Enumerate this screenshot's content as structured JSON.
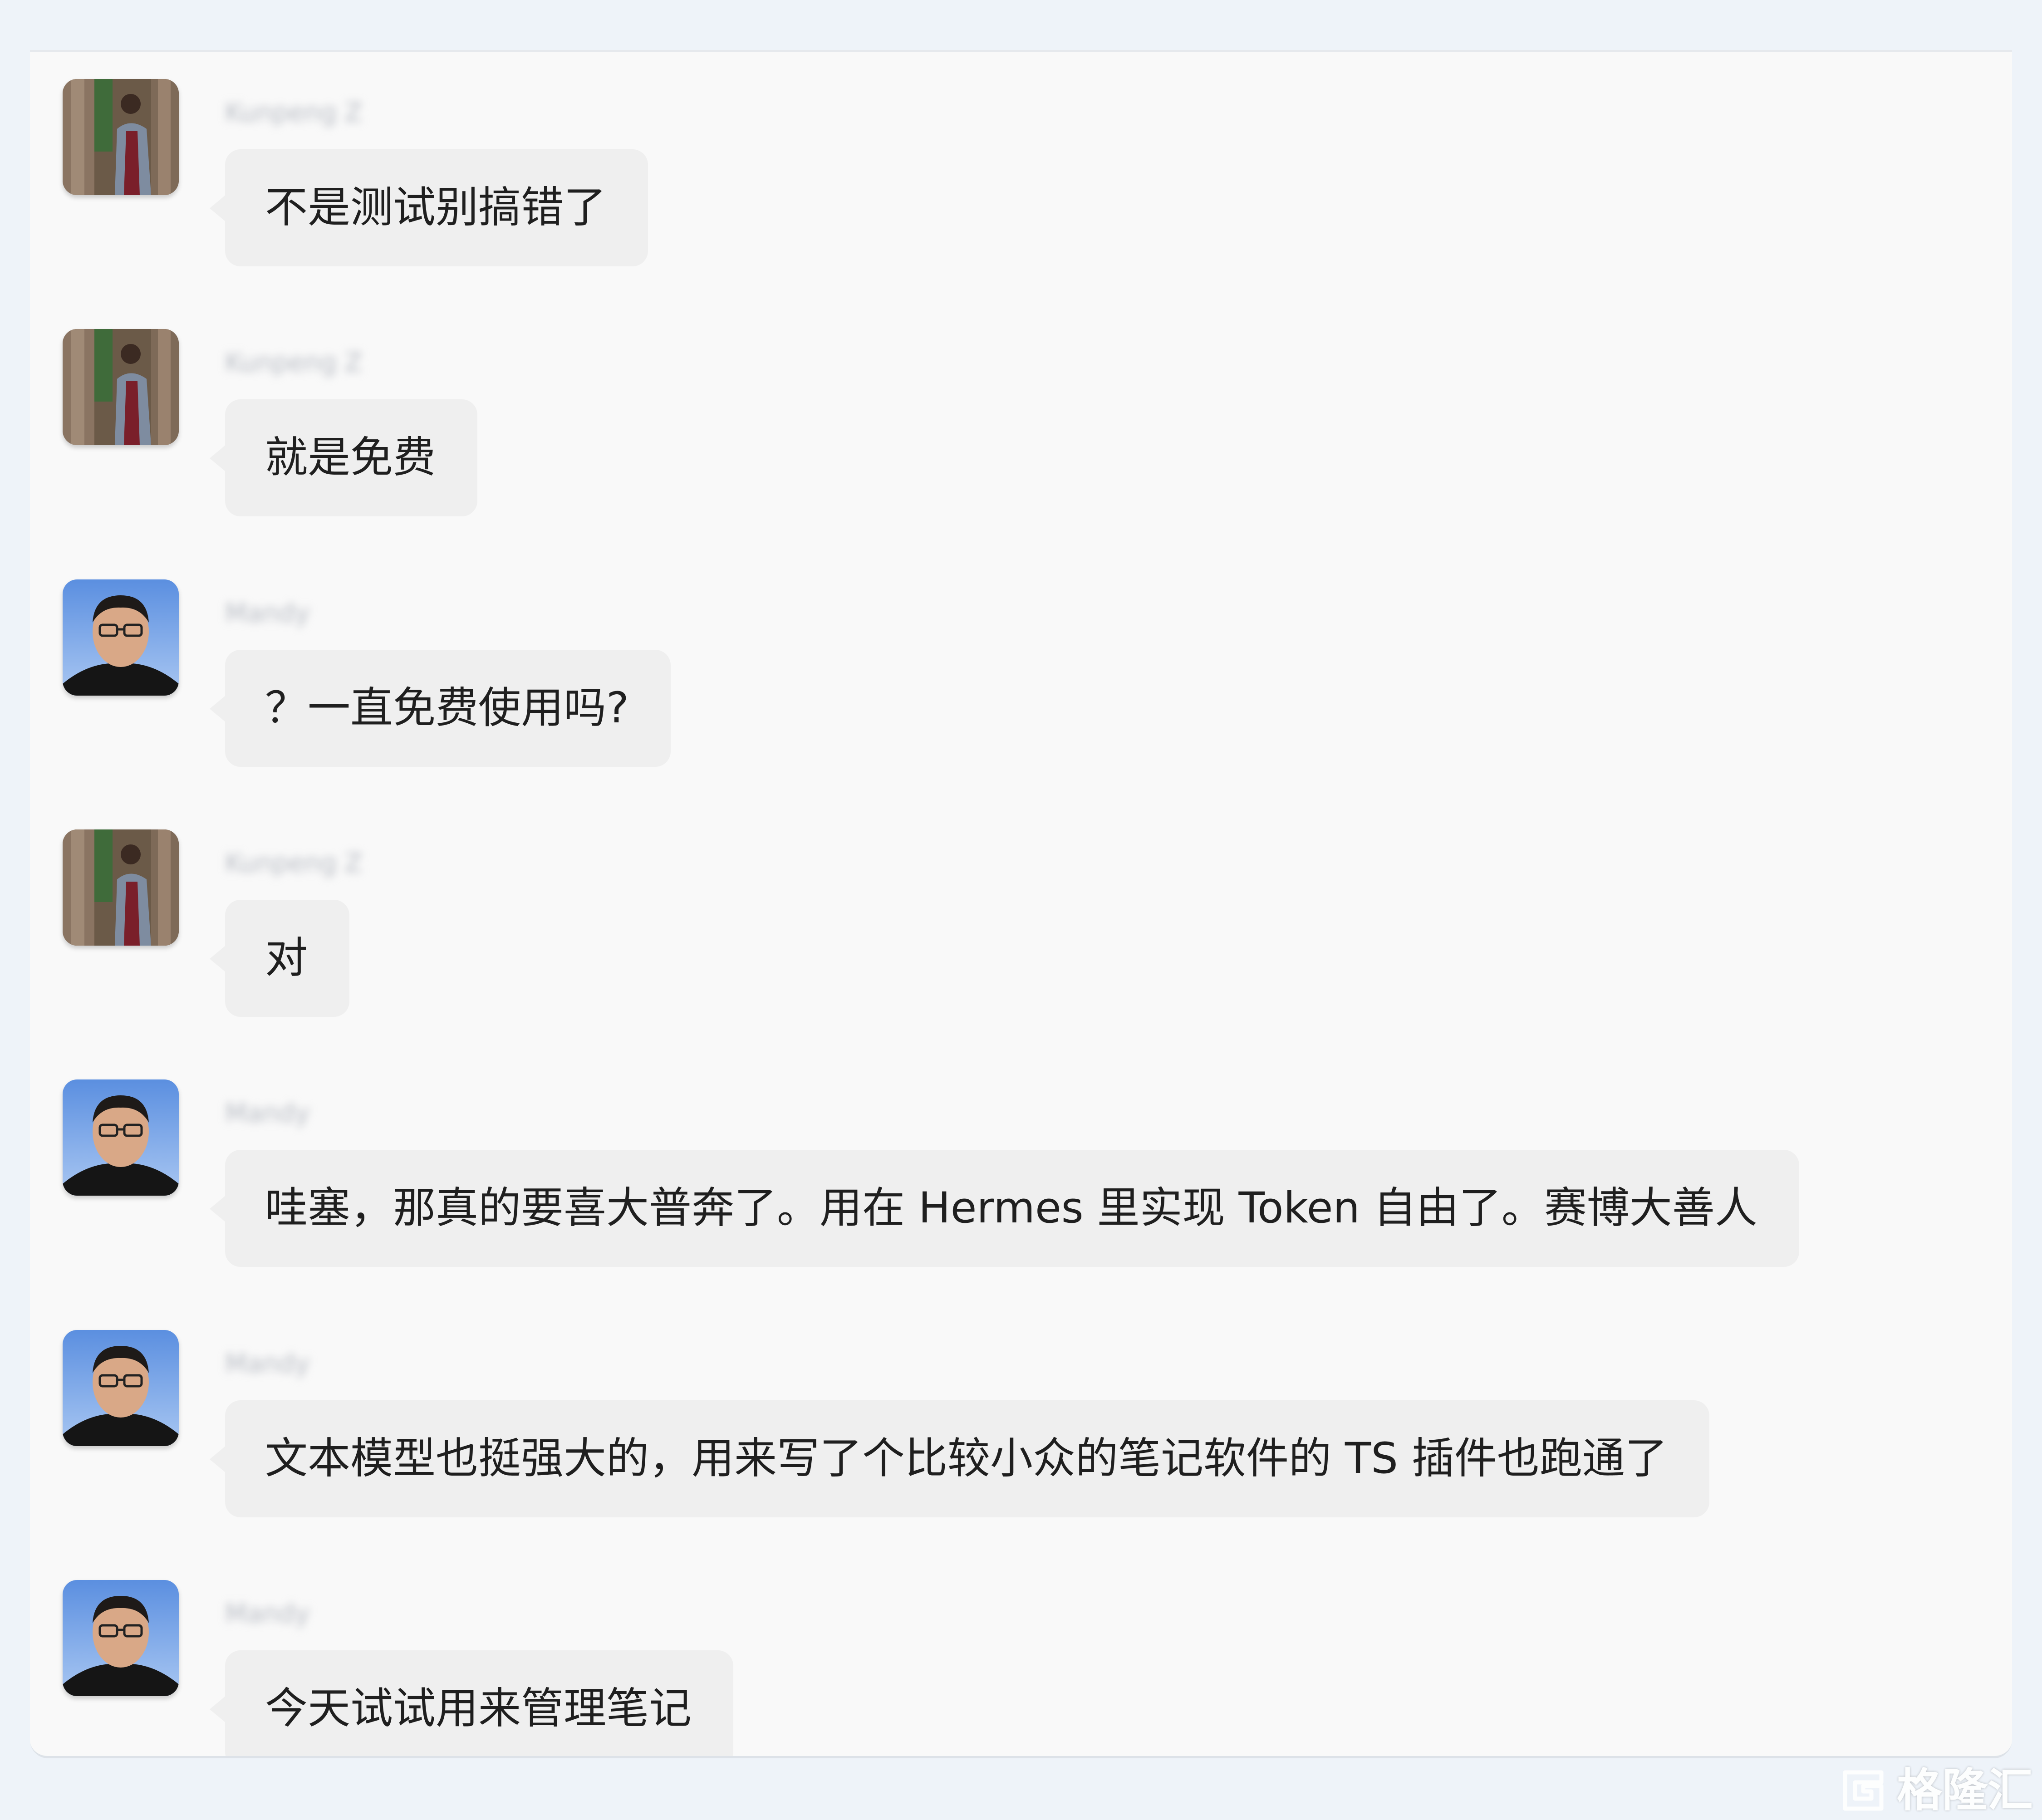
{
  "chat": {
    "messages": [
      {
        "sender": "Kunpeng Z",
        "avatar": "man-with-glasses-portrait-icon",
        "text": "不是测试别搞错了"
      },
      {
        "sender": "Kunpeng Z",
        "avatar": "man-with-glasses-portrait-icon",
        "text": "就是免费"
      },
      {
        "sender": "Mandy",
        "avatar": "man-portrait-icon",
        "text": "？一直免费使用吗?"
      },
      {
        "sender": "Kunpeng Z",
        "avatar": "man-with-glasses-portrait-icon",
        "text": "对"
      },
      {
        "sender": "Mandy",
        "avatar": "man-portrait-icon",
        "text": "哇塞，那真的要喜大普奔了。用在 Hermes 里实现 Token 自由了。赛博大善人"
      },
      {
        "sender": "Mandy",
        "avatar": "man-portrait-icon",
        "text": "文本模型也挺强大的，用来写了个比较小众的笔记软件的 TS 插件也跑通了"
      },
      {
        "sender": "Mandy",
        "avatar": "man-portrait-icon",
        "text": "今天试试用来管理笔记"
      }
    ]
  },
  "watermark": {
    "text": "格隆汇",
    "icon": "gelonghui-logo-icon"
  },
  "colors": {
    "page_background": "#EEF3F9",
    "chat_background": "#F9F9F9",
    "bubble_background": "#EFEFEF",
    "text": "#1F1F1F"
  }
}
